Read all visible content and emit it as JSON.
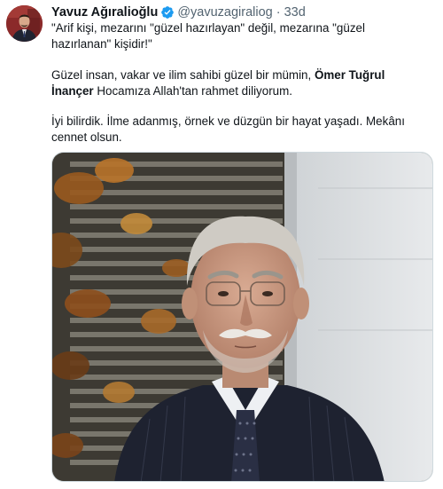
{
  "tweet": {
    "author_name": "Yavuz Ağıralioğlu",
    "handle": "@yavuzagiraliog",
    "separator": "·",
    "time": "33d",
    "verified": true,
    "paragraph1": "\"Arif kişi, mezarını \"güzel hazırlayan\" değil, mezarına \"güzel hazırlanan\" kişidir!\"",
    "paragraph2_before": "Güzel insan, vakar ve ilim sahibi güzel bir mümin, ",
    "paragraph2_bold": "Ömer Tuğrul İnançer",
    "paragraph2_after": " Hocamıza Allah'tan rahmet diliyorum.",
    "paragraph3": "İyi bilirdik. İlme adanmış, örnek ve düzgün bir hayat yaşadı. Mekânı cennet olsun."
  },
  "colors": {
    "verified_badge": "#1d9bf0",
    "secondary_text": "#536471",
    "primary_text": "#0f1419"
  },
  "icons": {
    "verified": "verified-badge-icon"
  }
}
